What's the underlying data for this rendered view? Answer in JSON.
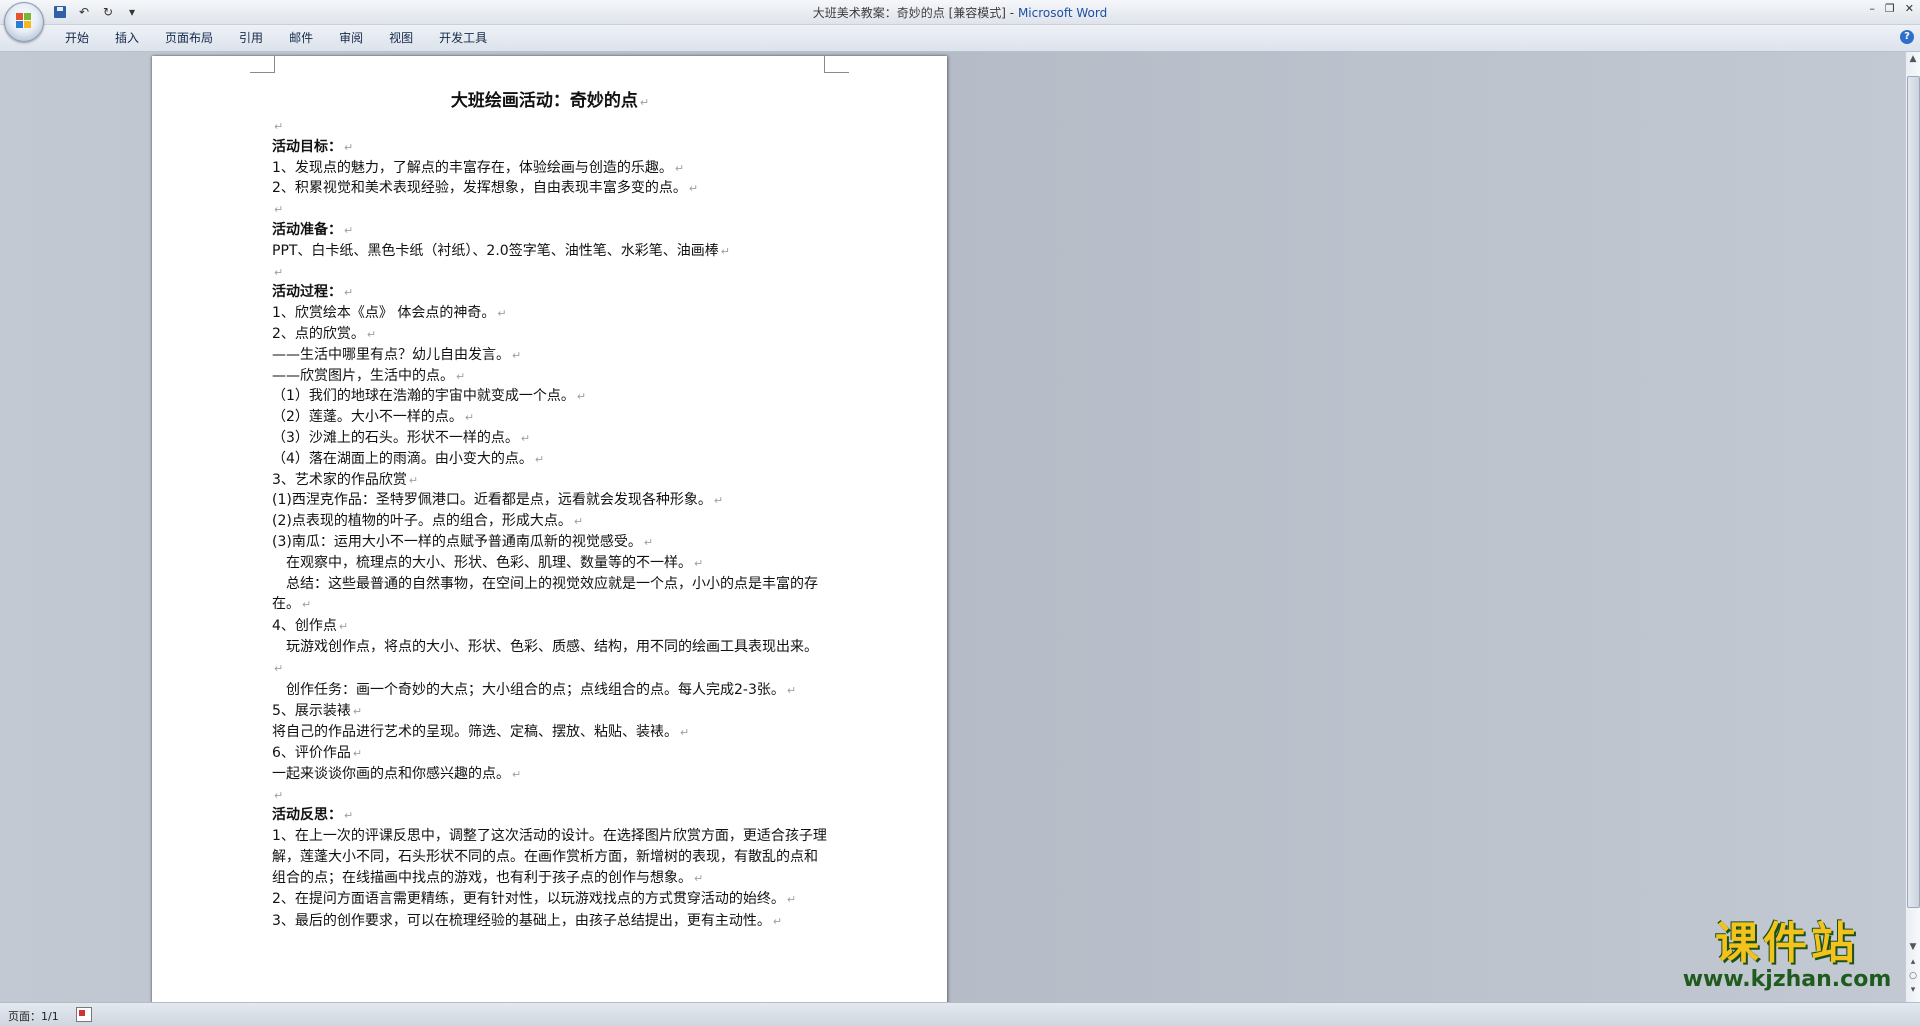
{
  "window": {
    "title_doc": "大班美术教案：奇妙的点 [兼容模式]",
    "title_sep": " - ",
    "title_app": "Microsoft Word",
    "minimize": "–",
    "restore": "❐",
    "close": "✕"
  },
  "qat": {
    "undo": "↶",
    "redo": "↻",
    "more": "▾"
  },
  "ribbon": {
    "tabs": [
      "开始",
      "插入",
      "页面布局",
      "引用",
      "邮件",
      "审阅",
      "视图",
      "开发工具"
    ],
    "help": "?"
  },
  "document": {
    "title": "大班绘画活动：奇妙的点",
    "mark": "↵",
    "lines": [
      {
        "text": "",
        "bold": false
      },
      {
        "text": "活动目标：",
        "bold": true
      },
      {
        "text": "1、发现点的魅力，了解点的丰富存在，体验绘画与创造的乐趣。",
        "bold": false
      },
      {
        "text": "2、积累视觉和美术表现经验，发挥想象，自由表现丰富多变的点。",
        "bold": false
      },
      {
        "text": "",
        "bold": false
      },
      {
        "text": "活动准备：",
        "bold": true
      },
      {
        "text": "PPT、白卡纸、黑色卡纸（衬纸）、2.0签字笔、油性笔、水彩笔、油画棒",
        "bold": false
      },
      {
        "text": "",
        "bold": false
      },
      {
        "text": "活动过程：",
        "bold": true
      },
      {
        "text": "1、欣赏绘本《点》 体会点的神奇。",
        "bold": false
      },
      {
        "text": "2、点的欣赏。",
        "bold": false
      },
      {
        "text": "——生活中哪里有点？幼儿自由发言。",
        "bold": false
      },
      {
        "text": "——欣赏图片，生活中的点。",
        "bold": false
      },
      {
        "text": "（1）我们的地球在浩瀚的宇宙中就变成一个点。",
        "bold": false
      },
      {
        "text": "（2）莲蓬。大小不一样的点。",
        "bold": false
      },
      {
        "text": "（3）沙滩上的石头。形状不一样的点。",
        "bold": false
      },
      {
        "text": "（4）落在湖面上的雨滴。由小变大的点。",
        "bold": false
      },
      {
        "text": "3、艺术家的作品欣赏",
        "bold": false
      },
      {
        "text": "(1)西涅克作品：圣特罗佩港口。近看都是点，远看就会发现各种形象。",
        "bold": false
      },
      {
        "text": "(2)点表现的植物的叶子。点的组合，形成大点。",
        "bold": false
      },
      {
        "text": "(3)南瓜：运用大小不一样的点赋予普通南瓜新的视觉感受。",
        "bold": false
      },
      {
        "text": "　在观察中，梳理点的大小、形状、色彩、肌理、数量等的不一样。",
        "bold": false
      },
      {
        "text": "　总结：这些最普通的自然事物，在空间上的视觉效应就是一个点，小小的点是丰富的存在。",
        "bold": false,
        "wrap": true
      },
      {
        "text": "4、创作点",
        "bold": false
      },
      {
        "text": "　玩游戏创作点，将点的大小、形状、色彩、质感、结构，用不同的绘画工具表现出来。",
        "bold": false,
        "wrap": true
      },
      {
        "text": "　创作任务：画一个奇妙的大点；大小组合的点；点线组合的点。每人完成2-3张。",
        "bold": false,
        "wrap": true
      },
      {
        "text": "5、展示装裱",
        "bold": false
      },
      {
        "text": " 将自己的作品进行艺术的呈现。筛选、定稿、摆放、粘贴、装裱。",
        "bold": false
      },
      {
        "text": "6、评价作品",
        "bold": false
      },
      {
        "text": " 一起来谈谈你画的点和你感兴趣的点。",
        "bold": false
      },
      {
        "text": "",
        "bold": false
      },
      {
        "text": "活动反思：",
        "bold": true
      },
      {
        "text": "1、在上一次的评课反思中，调整了这次活动的设计。在选择图片欣赏方面，更适合孩子理解，莲蓬大小不同，石头形状不同的点。在画作赏析方面，新增树的表现，有散乱的点和组合的点；在线描画中找点的游戏，也有利于孩子点的创作与想象。",
        "bold": false,
        "wrap": true
      },
      {
        "text": "2、在提问方面语言需更精练，更有针对性，以玩游戏找点的方式贯穿活动的始终。",
        "bold": false,
        "wrap": true
      },
      {
        "text": "3、最后的创作要求，可以在梳理经验的基础上，由孩子总结提出，更有主动性。",
        "bold": false
      }
    ]
  },
  "status": {
    "page": "页面：1/1"
  },
  "watermark": {
    "main": "课件站",
    "sub": "www.kjzhan.com"
  },
  "colors": {
    "accent": "#1f4fa0",
    "watermark_yellow": "#f4c21c",
    "watermark_green": "#1f5a1f"
  }
}
